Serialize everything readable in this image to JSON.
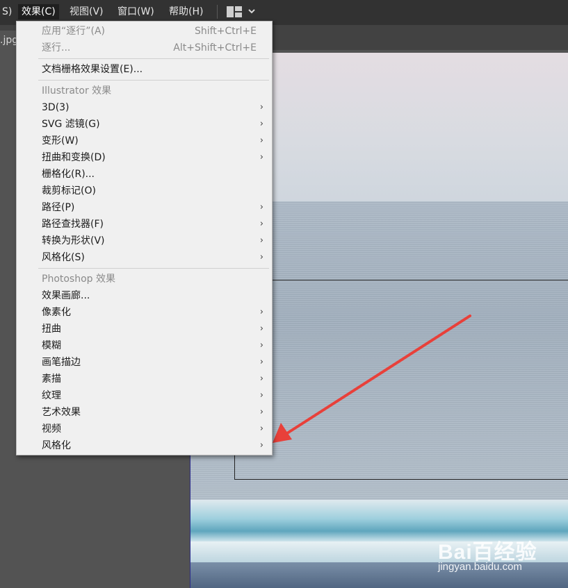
{
  "menubar": {
    "items": [
      {
        "label": "S)",
        "active": false
      },
      {
        "label": "效果(C)",
        "active": true
      },
      {
        "label": "视图(V)",
        "active": false
      },
      {
        "label": "窗口(W)",
        "active": false
      },
      {
        "label": "帮助(H)",
        "active": false
      }
    ],
    "workspace_icon": "layout-grid-icon",
    "workspace_chevron": "chevron-down-icon"
  },
  "document_tab": {
    "label": ".jpg"
  },
  "effect_menu": {
    "apply_last": {
      "label": "应用“逐行”(A)",
      "shortcut": "Shift+Ctrl+E"
    },
    "last_effect": {
      "label": "逐行...",
      "shortcut": "Alt+Shift+Ctrl+E"
    },
    "doc_raster_settings": {
      "label": "文档栅格效果设置(E)..."
    },
    "illustrator_header": "Illustrator 效果",
    "illustrator_items": [
      {
        "label": "3D(3)",
        "submenu": true
      },
      {
        "label": "SVG 滤镜(G)",
        "submenu": true
      },
      {
        "label": "变形(W)",
        "submenu": true
      },
      {
        "label": "扭曲和变换(D)",
        "submenu": true
      },
      {
        "label": "栅格化(R)...",
        "submenu": false
      },
      {
        "label": "裁剪标记(O)",
        "submenu": false
      },
      {
        "label": "路径(P)",
        "submenu": true
      },
      {
        "label": "路径查找器(F)",
        "submenu": true
      },
      {
        "label": "转换为形状(V)",
        "submenu": true
      },
      {
        "label": "风格化(S)",
        "submenu": true
      }
    ],
    "photoshop_header": "Photoshop 效果",
    "photoshop_items": [
      {
        "label": "效果画廊...",
        "submenu": false
      },
      {
        "label": "像素化",
        "submenu": true
      },
      {
        "label": "扭曲",
        "submenu": true
      },
      {
        "label": "模糊",
        "submenu": true
      },
      {
        "label": "画笔描边",
        "submenu": true
      },
      {
        "label": "素描",
        "submenu": true
      },
      {
        "label": "纹理",
        "submenu": true
      },
      {
        "label": "艺术效果",
        "submenu": true
      },
      {
        "label": "视频",
        "submenu": true
      },
      {
        "label": "风格化",
        "submenu": true
      }
    ],
    "submenu_glyph": "›"
  },
  "annotation": {
    "arrow_color": "#e8403a"
  },
  "watermark": {
    "brand": "Bai百经验",
    "url": "jingyan.baidu.com"
  }
}
